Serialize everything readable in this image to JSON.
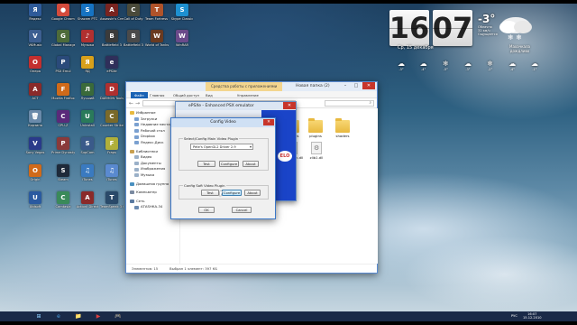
{
  "desktop_icons": [
    {
      "label": "Яндекс",
      "color": "#2e5a99",
      "glyph": "Я"
    },
    {
      "label": "Google Chrome",
      "color": "#d44b3c",
      "glyph": "●"
    },
    {
      "label": "Shazam PTC",
      "color": "#1673c2",
      "glyph": "S"
    },
    {
      "label": "Assassin's Creed",
      "color": "#7a2420",
      "glyph": "A"
    },
    {
      "label": "Call of Duty",
      "color": "#4a4a3a",
      "glyph": "C"
    },
    {
      "label": "Team Fortress 2",
      "color": "#b0532a",
      "glyph": "T"
    },
    {
      "label": "Skype Classic",
      "color": "#1e90d0",
      "glyph": "S"
    },
    {
      "label": "VKMusic",
      "color": "#3d5f91",
      "glyph": "V"
    },
    {
      "label": "Global Manager",
      "color": "#4d6b3a",
      "glyph": "G"
    },
    {
      "label": "Музыка",
      "color": "#b03030",
      "glyph": "♪"
    },
    {
      "label": "Battlefield 3",
      "color": "#3b3b3b",
      "glyph": "B"
    },
    {
      "label": "Battlefield 3",
      "color": "#4a4a4a",
      "glyph": "B"
    },
    {
      "label": "World of Tanks",
      "color": "#6a3a20",
      "glyph": "W"
    },
    {
      "label": "WinRAR",
      "color": "#6a4a8a",
      "glyph": "W"
    },
    {
      "label": "Опера",
      "color": "#c32f2f",
      "glyph": "O"
    },
    {
      "label": "PSX Emul",
      "color": "#2a4a7a",
      "glyph": "P"
    },
    {
      "label": "ЯД",
      "color": "#d8a01a",
      "glyph": "Я"
    },
    {
      "label": "ePSXe",
      "color": "#2f2f5a",
      "glyph": "e"
    },
    {
      "label": "ACT",
      "color": "#8a2a2a",
      "glyph": "A"
    },
    {
      "label": "Mozilla Firefox",
      "color": "#d06a1a",
      "glyph": "F"
    },
    {
      "label": "Лучший",
      "color": "#3a6a3a",
      "glyph": "Л"
    },
    {
      "label": "DAEMON Tools",
      "color": "#b03030",
      "glyph": "D"
    },
    {
      "label": "Корзина",
      "color": "#6a8aaa",
      "glyph": "🗑"
    },
    {
      "label": "CPU-Z",
      "color": "#5a2a7a",
      "glyph": "C"
    },
    {
      "label": "Uninstall",
      "color": "#2a7a5a",
      "glyph": "U"
    },
    {
      "label": "Counter Strike",
      "color": "#7a6a2a",
      "glyph": "C"
    },
    {
      "label": "Sony Vegas",
      "color": "#2a3a8a",
      "glyph": "V"
    },
    {
      "label": "Prime Dynasty",
      "color": "#8a3a3a",
      "glyph": "P"
    },
    {
      "label": "SupCom",
      "color": "#3a5a8a",
      "glyph": "S"
    },
    {
      "label": "Fraps",
      "color": "#b0b03a",
      "glyph": "F"
    },
    {
      "label": "Origin",
      "color": "#d06a1a",
      "glyph": "O"
    },
    {
      "label": "Steam",
      "color": "#1e2a3a",
      "glyph": "S"
    },
    {
      "label": "iTunes",
      "color": "#3a7ac0",
      "glyph": "♫"
    },
    {
      "label": "iTunes",
      "color": "#5a8ad0",
      "glyph": "♫"
    },
    {
      "label": "Ubisoft",
      "color": "#2a5aa0",
      "glyph": "U"
    },
    {
      "label": "Camtasia",
      "color": "#3a8a5a",
      "glyph": "C"
    },
    {
      "label": "Action! Direct",
      "color": "#8a2a2a",
      "glyph": "A"
    },
    {
      "label": "TeamSpeak 3 Client",
      "color": "#2a4a6a",
      "glyph": "T"
    }
  ],
  "widget": {
    "hour": "16",
    "minute": "07",
    "date": "Ср, 15 декабря",
    "temp": "-3°",
    "weather_line1": "Облачно",
    "weather_line2": "32 км/ч",
    "weather_line3": "Ощущается",
    "city_line1": "Махачкала",
    "city_line2": "дождливо",
    "forecast": [
      {
        "icon": "☁",
        "label": "-3°"
      },
      {
        "icon": "☁",
        "label": "-4°"
      },
      {
        "icon": "❄",
        "label": "-5°"
      },
      {
        "icon": "☁",
        "label": "-3°"
      },
      {
        "icon": "❄",
        "label": "-2°"
      },
      {
        "icon": "☁",
        "label": "-4°"
      },
      {
        "icon": "☁",
        "label": "-1°"
      }
    ]
  },
  "explorer": {
    "tool_tab": "Средства работы с приложениями",
    "title": "Новая папка (2)",
    "file_tab": "Файл",
    "menu": [
      "Главная",
      "Общий доступ",
      "Вид",
      "Управление"
    ],
    "nav": {
      "favorites_header": "Избранное",
      "favorites": [
        "Загрузки",
        "Недавние места",
        "Рабочий стол",
        "Dropbox",
        "Яндекс.Диск"
      ],
      "libraries_header": "Библиотеки",
      "libraries": [
        "Видео",
        "Документы",
        "Изображения",
        "Музыка"
      ],
      "homegroup": "Домашняя группа",
      "computer_header": "Компьютер",
      "network_header": "Сеть",
      "network": [
        "АТАSНКА-34"
      ]
    },
    "items": [
      {
        "name": "patches",
        "kind": "folder"
      },
      {
        "name": "plugins",
        "kind": "folder"
      },
      {
        "name": "shaders",
        "kind": "folder"
      },
      {
        "name": "keflection.dll",
        "kind": "file"
      },
      {
        "name": "zlib1.dll",
        "kind": "file"
      }
    ],
    "status_count": "Элементов: 15",
    "status_selected": "Выбран 1 элемент: 397 КБ"
  },
  "epsxe": {
    "title": "ePSXe - Enhanced PSX emulator",
    "logo_text": "ELO"
  },
  "config_dialog": {
    "title": "Config Video",
    "main_group": "Select/Config Main Video Plugin",
    "main_plugin": "Pete's OpenGL2 Driver 2.9",
    "soft_group": "Config Soft Video Plugin",
    "test": "Test",
    "configure": "Configure",
    "about": "About",
    "ok": "OK",
    "cancel": "Cancel"
  },
  "taskbar": {
    "lang": "РУС",
    "time": "16:07",
    "date": "15.12.2010",
    "items": [
      "⊞",
      "e",
      "📁",
      "▶",
      "🎮"
    ]
  }
}
